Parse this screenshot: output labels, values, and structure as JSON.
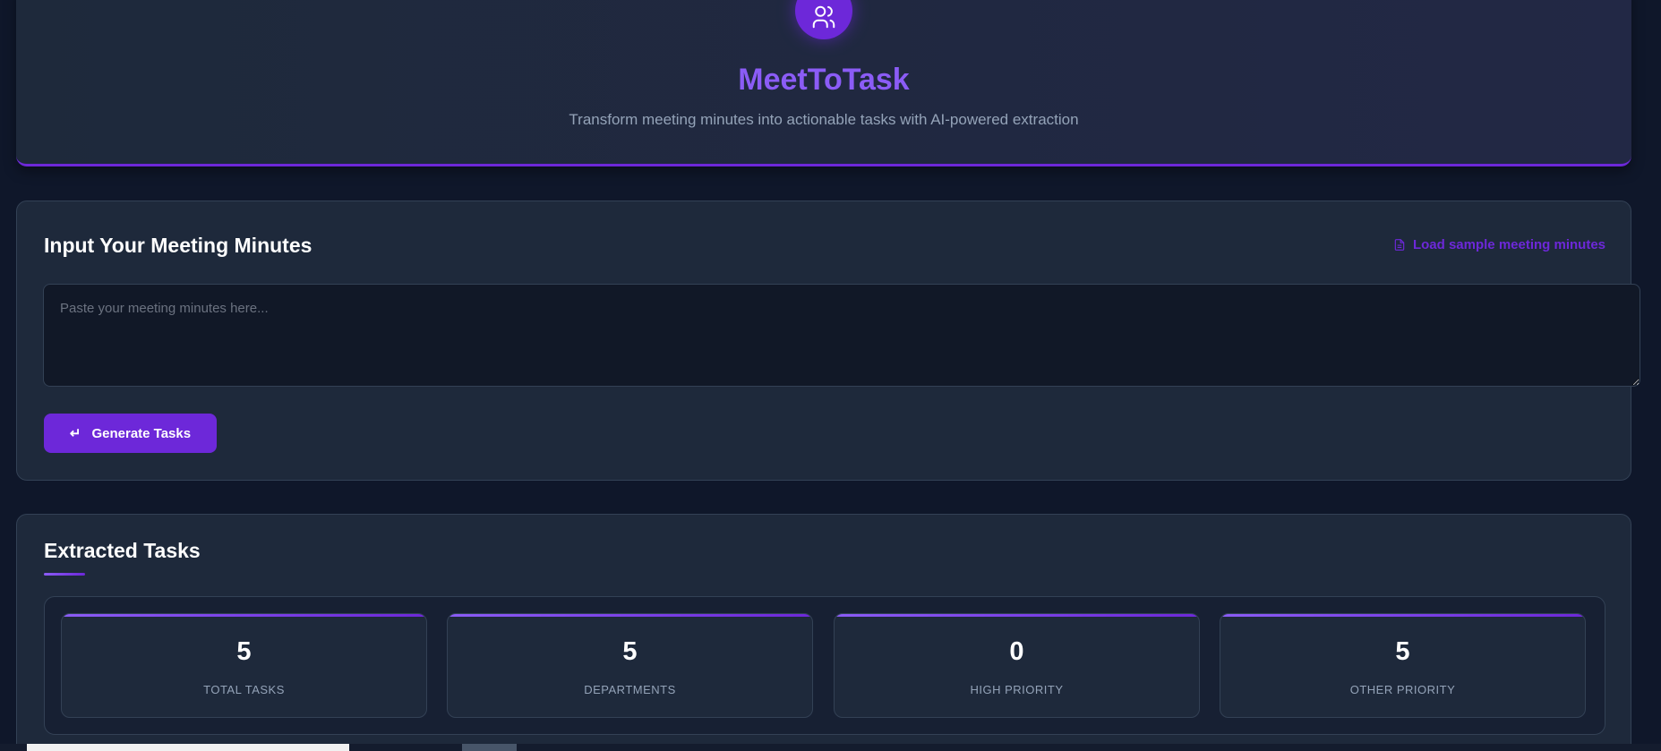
{
  "header": {
    "title": "MeetToTask",
    "subtitle": "Transform meeting minutes into actionable tasks with AI-powered extraction",
    "logo_icon": "users-icon"
  },
  "input": {
    "heading": "Input Your Meeting Minutes",
    "load_sample_label": "Load sample meeting minutes",
    "textarea_value": "",
    "textarea_placeholder": "Paste your meeting minutes here...",
    "generate_label": "Generate Tasks"
  },
  "tasks": {
    "heading": "Extracted Tasks",
    "stats": [
      {
        "value": "5",
        "label": "TOTAL TASKS"
      },
      {
        "value": "5",
        "label": "DEPARTMENTS"
      },
      {
        "value": "0",
        "label": "HIGH PRIORITY"
      },
      {
        "value": "5",
        "label": "OTHER PRIORITY"
      }
    ]
  },
  "colors": {
    "accent": "#6d28d9",
    "title": "#8b5cf6",
    "background": "#0f172a",
    "card": "#1e293b"
  }
}
